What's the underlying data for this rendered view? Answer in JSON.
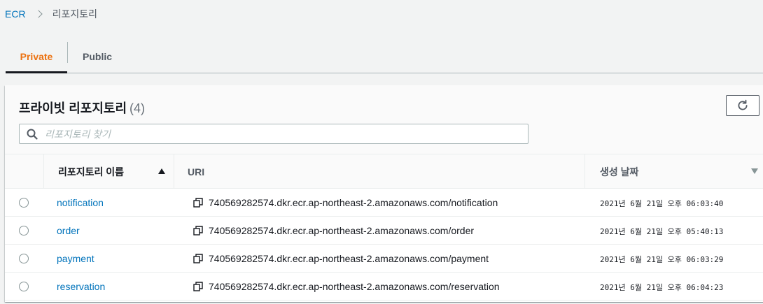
{
  "breadcrumb": {
    "root": "ECR",
    "current": "리포지토리"
  },
  "tabs": [
    {
      "label": "Private",
      "active": true
    },
    {
      "label": "Public",
      "active": false
    }
  ],
  "panel": {
    "title": "프라이빗 리포지토리",
    "count": "(4)",
    "refresh_icon": "refresh-icon"
  },
  "search": {
    "placeholder": "리포지토리 찾기",
    "value": ""
  },
  "table": {
    "columns": {
      "name": "리포지토리 이름",
      "uri": "URI",
      "created": "생성 날짜"
    },
    "rows": [
      {
        "name": "notification",
        "uri": "740569282574.dkr.ecr.ap-northeast-2.amazonaws.com/notification",
        "created": "2021년 6월 21일 오후 06:03:40"
      },
      {
        "name": "order",
        "uri": "740569282574.dkr.ecr.ap-northeast-2.amazonaws.com/order",
        "created": "2021년 6월 21일 오후 05:40:13"
      },
      {
        "name": "payment",
        "uri": "740569282574.dkr.ecr.ap-northeast-2.amazonaws.com/payment",
        "created": "2021년 6월 21일 오후 06:03:29"
      },
      {
        "name": "reservation",
        "uri": "740569282574.dkr.ecr.ap-northeast-2.amazonaws.com/reservation",
        "created": "2021년 6월 21일 오후 06:04:23"
      }
    ]
  },
  "colors": {
    "accent": "#ec7211",
    "link": "#0073bb",
    "text": "#16191f"
  }
}
